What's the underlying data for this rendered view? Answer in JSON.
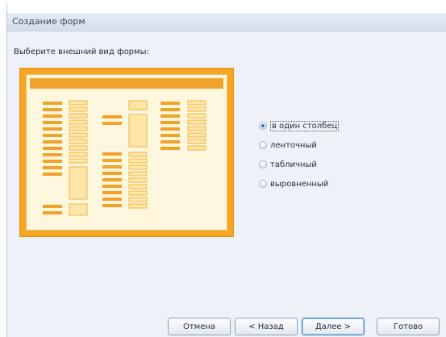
{
  "window": {
    "title": "Создание форм"
  },
  "prompt": "Выберите внешний вид формы:",
  "layout_options": [
    {
      "label": "в один столбец",
      "selected": true
    },
    {
      "label": "ленточный",
      "selected": false
    },
    {
      "label": "табличный",
      "selected": false
    },
    {
      "label": "выровненный",
      "selected": false
    }
  ],
  "buttons": {
    "cancel": "Отмена",
    "back": "< Назад",
    "next": "Далее >",
    "finish": "Готово"
  },
  "colors": {
    "preview_frame": "#f4a624",
    "preview_fill": "#fff6de",
    "field": "#f0a22a",
    "field_light": "#fde7a8"
  }
}
